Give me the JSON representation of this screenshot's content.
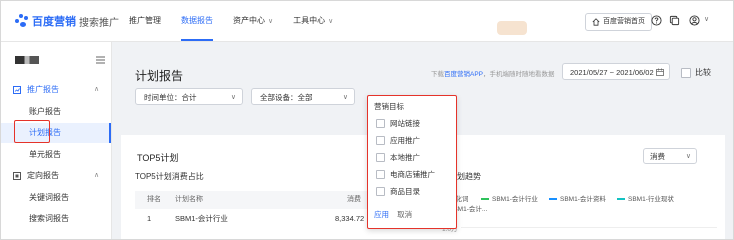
{
  "brand": {
    "name": "百度营销",
    "product": "搜索推广"
  },
  "nav": {
    "tabs": [
      "推广管理",
      "数据报告",
      "资产中心",
      "工具中心"
    ],
    "home_label": "百度营销首页"
  },
  "sidebar": {
    "groups": [
      {
        "label": "推广报告",
        "items": [
          "账户报告",
          "计划报告",
          "单元报告"
        ]
      },
      {
        "label": "定向报告",
        "items": [
          "关键词报告",
          "搜索词报告"
        ]
      }
    ]
  },
  "main": {
    "title": "计划报告",
    "hint_prefix": "下载",
    "hint_link": "百度营销APP",
    "hint_suffix": "，手机端随时随地看数据",
    "date_range": "2021/05/27 ~ 2021/06/02",
    "compare_label": "比较",
    "filters": {
      "time_unit_label": "时间单位：",
      "time_unit_value": "合计",
      "device_label": "全部设备：",
      "device_value": "全部"
    }
  },
  "top5": {
    "title": "TOP5计划",
    "subtitle": "TOP5计划消费占比",
    "metric": "消费",
    "trend_title": "计划趋势",
    "columns": [
      "排名",
      "计划名称",
      "消费"
    ],
    "rows": [
      {
        "rank": "1",
        "name": "SBM1-会计行业",
        "value": "8,334.72"
      }
    ],
    "legend": [
      "SBM1-会计行业",
      "SBM1-会计资料",
      "SBM1-行业现状"
    ],
    "legend_prefix_clipped": "机化词",
    "legend_clipped_second_line": "SBM1-会计...",
    "y_tick": "1.0万"
  },
  "popup": {
    "title": "营销目标",
    "options": [
      "网站链接",
      "应用推广",
      "本地推广",
      "电商店铺推广",
      "商品目录"
    ],
    "apply": "应用",
    "cancel": "取消"
  },
  "colors": {
    "accent": "#2c6cf6",
    "highlight_box": "#e5332a",
    "legend": [
      "#2fc25b",
      "#1890ff",
      "#13c2c2"
    ]
  }
}
